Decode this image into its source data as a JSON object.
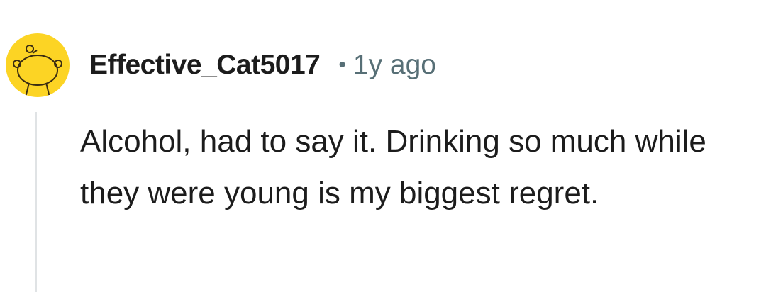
{
  "comment": {
    "author": {
      "username": "Effective_Cat5017",
      "avatar_icon": "snoo-avatar-icon",
      "avatar_bg": "#fcd424"
    },
    "separator": "•",
    "timestamp": "1y ago",
    "body": "Alcohol, had to say it. Drinking so much while they were young is my biggest regret."
  }
}
